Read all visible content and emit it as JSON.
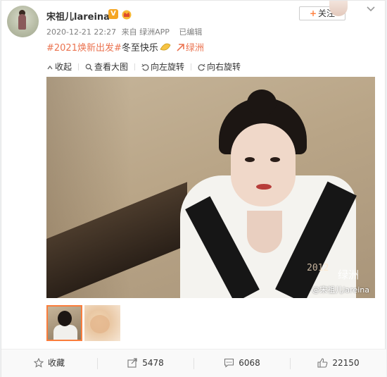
{
  "post": {
    "username": "宋祖儿lareina",
    "verified_badge": "V",
    "timestamp": "2020-12-21 22:27",
    "source": "来自 绿洲APP",
    "edited_label": "已编辑",
    "follow_label": "关注",
    "content": {
      "hashtag": "#2021焕新出发#",
      "text": "冬至快乐",
      "location": "绿洲"
    }
  },
  "toolbar": {
    "collapse_label": "收起",
    "view_large_label": "查看大图",
    "rotate_left_label": "向左旋转",
    "rotate_right_label": "向右旋转"
  },
  "photo": {
    "watermark_date": "2012",
    "watermark_brand": "绿洲",
    "watermark_user": "@宋祖儿lareina"
  },
  "actions": {
    "favorite_label": "收藏",
    "repost_count": "5478",
    "comment_count": "6068",
    "like_count": "22150"
  },
  "colors": {
    "accent": "#eb7350",
    "follow_plus": "#ff8140",
    "thumb_selected": "#fa7d3c",
    "verified": "#f5a623"
  },
  "icons": [
    "crown-icon",
    "chevron-down-icon",
    "moon-emoji-icon",
    "location-icon",
    "collapse-icon",
    "magnifier-icon",
    "rotate-left-icon",
    "rotate-right-icon",
    "star-icon",
    "repost-icon",
    "comment-icon",
    "like-icon"
  ]
}
